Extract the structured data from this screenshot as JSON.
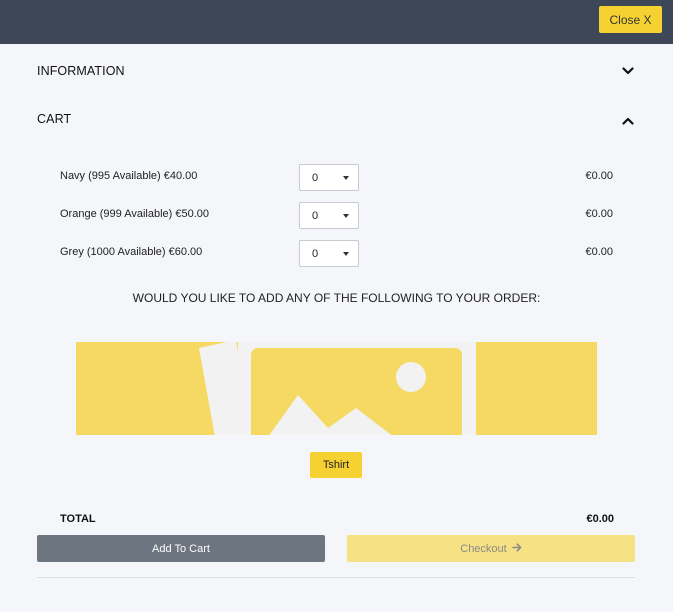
{
  "header": {
    "close_label": "Close X"
  },
  "sections": {
    "information": {
      "label": "INFORMATION",
      "expanded": false
    },
    "cart": {
      "label": "CART",
      "expanded": true
    }
  },
  "cart": {
    "items": [
      {
        "label": "Navy (995 Available) €40.00",
        "qty": "0",
        "price": "€0.00"
      },
      {
        "label": "Orange (999 Available) €50.00",
        "qty": "0",
        "price": "€0.00"
      },
      {
        "label": "Grey (1000 Available) €60.00",
        "qty": "0",
        "price": "€0.00"
      }
    ]
  },
  "upsell": {
    "title": "WOULD YOU LIKE TO ADD ANY OF THE FOLLOWING TO YOUR ORDER:",
    "product_button": "Tshirt"
  },
  "summary": {
    "total_label": "TOTAL",
    "total_value": "€0.00"
  },
  "actions": {
    "add_to_cart": "Add To Cart",
    "checkout": "Checkout"
  },
  "icons": {
    "information_toggle": "chevron-down-icon",
    "cart_toggle": "chevron-up-icon",
    "checkout": "arrow-right-icon",
    "placeholder": "image-placeholder-icon"
  },
  "colors": {
    "header_bg": "#3d4758",
    "accent": "#f5d232",
    "add_to_cart_bg": "#6c7580",
    "checkout_disabled_bg": "#f6e282"
  }
}
